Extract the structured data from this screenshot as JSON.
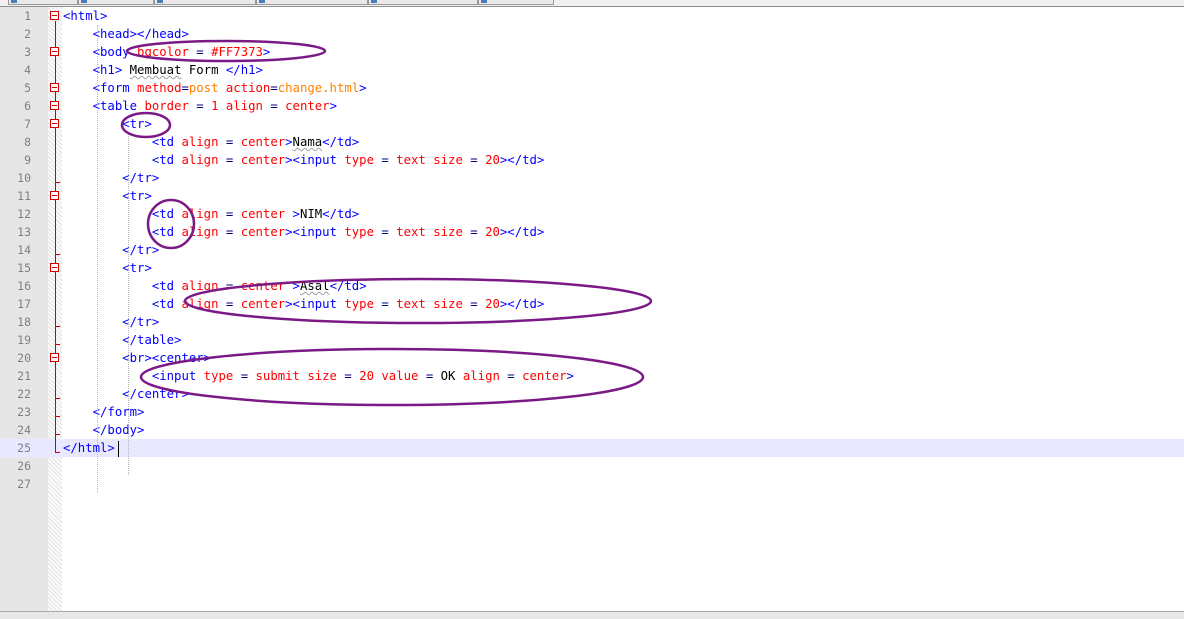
{
  "editor": {
    "tabs": [
      "",
      "",
      "",
      "",
      ""
    ],
    "current_line": 25,
    "lines": [
      {
        "n": "1",
        "tokens": [
          {
            "t": "<html>",
            "c": "tag"
          }
        ]
      },
      {
        "n": "2",
        "tokens": [
          {
            "t": "    ",
            "c": "txt"
          },
          {
            "t": "<head></head>",
            "c": "tag"
          }
        ]
      },
      {
        "n": "3",
        "tokens": [
          {
            "t": "    ",
            "c": "txt"
          },
          {
            "t": "<body ",
            "c": "tag"
          },
          {
            "t": "bgcolor",
            "c": "attr"
          },
          {
            "t": " = ",
            "c": "op"
          },
          {
            "t": "#FF7373",
            "c": "attr"
          },
          {
            "t": ">",
            "c": "tag"
          }
        ]
      },
      {
        "n": "4",
        "tokens": [
          {
            "t": "    ",
            "c": "txt"
          },
          {
            "t": "<h1>",
            "c": "tag"
          },
          {
            "t": " ",
            "c": "txt"
          },
          {
            "t": "Membuat",
            "c": "txt",
            "sq": true
          },
          {
            "t": " Form ",
            "c": "txt"
          },
          {
            "t": "</h1>",
            "c": "tag"
          }
        ]
      },
      {
        "n": "5",
        "tokens": [
          {
            "t": "    ",
            "c": "txt"
          },
          {
            "t": "<form ",
            "c": "tag"
          },
          {
            "t": "method",
            "c": "attr"
          },
          {
            "t": "=",
            "c": "op"
          },
          {
            "t": "post",
            "c": "str"
          },
          {
            "t": " ",
            "c": "txt"
          },
          {
            "t": "action",
            "c": "attr"
          },
          {
            "t": "=",
            "c": "op"
          },
          {
            "t": "change.html",
            "c": "str"
          },
          {
            "t": ">",
            "c": "tag"
          }
        ]
      },
      {
        "n": "6",
        "tokens": [
          {
            "t": "    ",
            "c": "txt"
          },
          {
            "t": "<table ",
            "c": "tag"
          },
          {
            "t": "border",
            "c": "attr"
          },
          {
            "t": " = ",
            "c": "op"
          },
          {
            "t": "1",
            "c": "attr"
          },
          {
            "t": " ",
            "c": "txt"
          },
          {
            "t": "align",
            "c": "attr"
          },
          {
            "t": " = ",
            "c": "op"
          },
          {
            "t": "center",
            "c": "attr"
          },
          {
            "t": ">",
            "c": "tag"
          }
        ]
      },
      {
        "n": "7",
        "tokens": [
          {
            "t": "        ",
            "c": "txt"
          },
          {
            "t": "<tr>",
            "c": "tag"
          }
        ]
      },
      {
        "n": "8",
        "tokens": [
          {
            "t": "            ",
            "c": "txt"
          },
          {
            "t": "<td ",
            "c": "tag"
          },
          {
            "t": "align",
            "c": "attr"
          },
          {
            "t": " = ",
            "c": "op"
          },
          {
            "t": "center",
            "c": "attr"
          },
          {
            "t": ">",
            "c": "tag"
          },
          {
            "t": "Nama",
            "c": "txt",
            "sq": true
          },
          {
            "t": "</td>",
            "c": "tag"
          }
        ]
      },
      {
        "n": "9",
        "tokens": [
          {
            "t": "            ",
            "c": "txt"
          },
          {
            "t": "<td ",
            "c": "tag"
          },
          {
            "t": "align",
            "c": "attr"
          },
          {
            "t": " = ",
            "c": "op"
          },
          {
            "t": "center",
            "c": "attr"
          },
          {
            "t": "><input ",
            "c": "tag"
          },
          {
            "t": "type",
            "c": "attr"
          },
          {
            "t": " = ",
            "c": "op"
          },
          {
            "t": "text",
            "c": "attr"
          },
          {
            "t": " ",
            "c": "txt"
          },
          {
            "t": "size",
            "c": "attr"
          },
          {
            "t": " = ",
            "c": "op"
          },
          {
            "t": "20",
            "c": "attr"
          },
          {
            "t": "></td>",
            "c": "tag"
          }
        ]
      },
      {
        "n": "10",
        "tokens": [
          {
            "t": "        ",
            "c": "txt"
          },
          {
            "t": "</tr>",
            "c": "tag"
          }
        ]
      },
      {
        "n": "11",
        "tokens": [
          {
            "t": "        ",
            "c": "txt"
          },
          {
            "t": "<tr>",
            "c": "tag"
          }
        ]
      },
      {
        "n": "12",
        "tokens": [
          {
            "t": "            ",
            "c": "txt"
          },
          {
            "t": "<td ",
            "c": "tag"
          },
          {
            "t": "align",
            "c": "attr"
          },
          {
            "t": " = ",
            "c": "op"
          },
          {
            "t": "center",
            "c": "attr"
          },
          {
            "t": " >",
            "c": "tag"
          },
          {
            "t": "NIM",
            "c": "txt"
          },
          {
            "t": "</td>",
            "c": "tag"
          }
        ]
      },
      {
        "n": "13",
        "tokens": [
          {
            "t": "            ",
            "c": "txt"
          },
          {
            "t": "<td ",
            "c": "tag"
          },
          {
            "t": "align",
            "c": "attr"
          },
          {
            "t": " = ",
            "c": "op"
          },
          {
            "t": "center",
            "c": "attr"
          },
          {
            "t": "><input ",
            "c": "tag"
          },
          {
            "t": "type",
            "c": "attr"
          },
          {
            "t": " = ",
            "c": "op"
          },
          {
            "t": "text",
            "c": "attr"
          },
          {
            "t": " ",
            "c": "txt"
          },
          {
            "t": "size",
            "c": "attr"
          },
          {
            "t": " = ",
            "c": "op"
          },
          {
            "t": "20",
            "c": "attr"
          },
          {
            "t": "></td>",
            "c": "tag"
          }
        ]
      },
      {
        "n": "14",
        "tokens": [
          {
            "t": "        ",
            "c": "txt"
          },
          {
            "t": "</tr>",
            "c": "tag"
          }
        ]
      },
      {
        "n": "15",
        "tokens": [
          {
            "t": "        ",
            "c": "txt"
          },
          {
            "t": "<tr>",
            "c": "tag"
          }
        ]
      },
      {
        "n": "16",
        "tokens": [
          {
            "t": "            ",
            "c": "txt"
          },
          {
            "t": "<td ",
            "c": "tag"
          },
          {
            "t": "align",
            "c": "attr"
          },
          {
            "t": " = ",
            "c": "op"
          },
          {
            "t": "center",
            "c": "attr"
          },
          {
            "t": " >",
            "c": "tag"
          },
          {
            "t": "Asal",
            "c": "txt",
            "sq": true
          },
          {
            "t": "</td>",
            "c": "tag"
          }
        ]
      },
      {
        "n": "17",
        "tokens": [
          {
            "t": "            ",
            "c": "txt"
          },
          {
            "t": "<td ",
            "c": "tag"
          },
          {
            "t": "align",
            "c": "attr"
          },
          {
            "t": " = ",
            "c": "op"
          },
          {
            "t": "center",
            "c": "attr"
          },
          {
            "t": "><input ",
            "c": "tag"
          },
          {
            "t": "type",
            "c": "attr"
          },
          {
            "t": " = ",
            "c": "op"
          },
          {
            "t": "text",
            "c": "attr"
          },
          {
            "t": " ",
            "c": "txt"
          },
          {
            "t": "size",
            "c": "attr"
          },
          {
            "t": " = ",
            "c": "op"
          },
          {
            "t": "20",
            "c": "attr"
          },
          {
            "t": "></td>",
            "c": "tag"
          }
        ]
      },
      {
        "n": "18",
        "tokens": [
          {
            "t": "        ",
            "c": "txt"
          },
          {
            "t": "</tr>",
            "c": "tag"
          }
        ]
      },
      {
        "n": "19",
        "tokens": [
          {
            "t": "        ",
            "c": "txt"
          },
          {
            "t": "</table>",
            "c": "tag"
          }
        ]
      },
      {
        "n": "20",
        "tokens": [
          {
            "t": "        ",
            "c": "txt"
          },
          {
            "t": "<br><center>",
            "c": "tag"
          }
        ]
      },
      {
        "n": "21",
        "tokens": [
          {
            "t": "            ",
            "c": "txt"
          },
          {
            "t": "<input ",
            "c": "tag"
          },
          {
            "t": "type",
            "c": "attr"
          },
          {
            "t": " = ",
            "c": "op"
          },
          {
            "t": "submit",
            "c": "attr"
          },
          {
            "t": " ",
            "c": "txt"
          },
          {
            "t": "size",
            "c": "attr"
          },
          {
            "t": " = ",
            "c": "op"
          },
          {
            "t": "20",
            "c": "attr"
          },
          {
            "t": " ",
            "c": "txt"
          },
          {
            "t": "value",
            "c": "attr"
          },
          {
            "t": " = ",
            "c": "op"
          },
          {
            "t": "OK",
            "c": "txt"
          },
          {
            "t": " ",
            "c": "txt"
          },
          {
            "t": "align",
            "c": "attr"
          },
          {
            "t": " = ",
            "c": "op"
          },
          {
            "t": "center",
            "c": "attr"
          },
          {
            "t": ">",
            "c": "tag"
          }
        ]
      },
      {
        "n": "22",
        "tokens": [
          {
            "t": "        ",
            "c": "txt"
          },
          {
            "t": "</center>",
            "c": "tag"
          }
        ]
      },
      {
        "n": "23",
        "tokens": [
          {
            "t": "    ",
            "c": "txt"
          },
          {
            "t": "</form>",
            "c": "tag"
          }
        ]
      },
      {
        "n": "24",
        "tokens": [
          {
            "t": "    ",
            "c": "txt"
          },
          {
            "t": "</body>",
            "c": "tag"
          }
        ]
      },
      {
        "n": "25",
        "tokens": [
          {
            "t": "</html>",
            "c": "tag"
          }
        ]
      },
      {
        "n": "26",
        "tokens": []
      },
      {
        "n": "27",
        "tokens": []
      }
    ]
  },
  "colors": {
    "tag": "#0000ff",
    "attribute": "#ff0000",
    "string": "#ff8000",
    "text": "#000000",
    "line_number": "#808080",
    "current_line": "#e8e8ff",
    "fold_marker": "#cc0000",
    "annotation_stroke": "#7b1a86"
  }
}
